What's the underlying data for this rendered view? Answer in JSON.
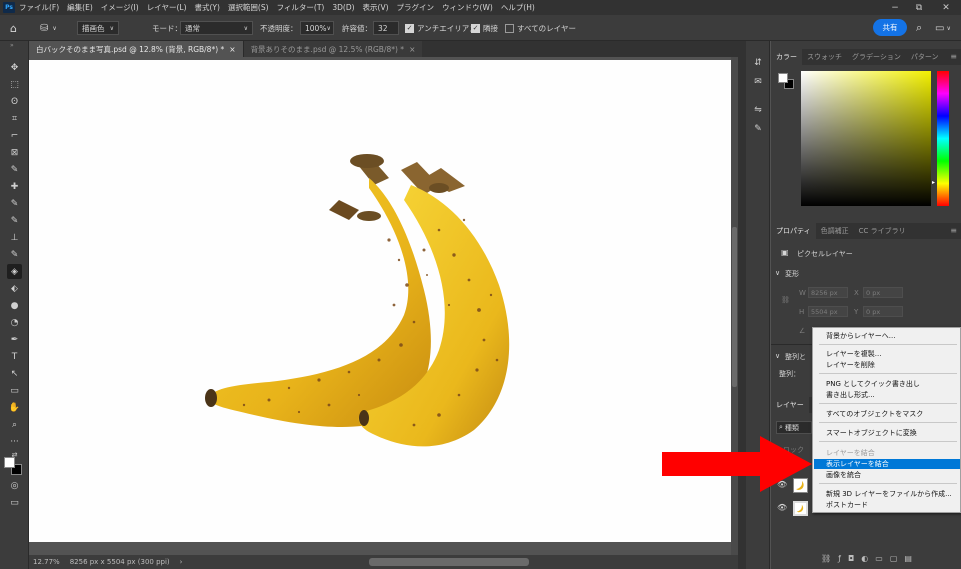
{
  "app": {
    "logo": "Ps"
  },
  "menubar": {
    "items": [
      "ファイル(F)",
      "編集(E)",
      "イメージ(I)",
      "レイヤー(L)",
      "書式(Y)",
      "選択範囲(S)",
      "フィルター(T)",
      "3D(D)",
      "表示(V)",
      "プラグイン",
      "ウィンドウ(W)",
      "ヘルプ(H)"
    ],
    "window_controls": [
      "−",
      "⧉",
      "✕"
    ]
  },
  "options": {
    "home_icon": "⌂",
    "tool_icon": "⛁",
    "fill_source": "描画色",
    "mode_label": "モード：",
    "mode_value": "通常",
    "opacity_label": "不透明度：",
    "opacity_value": "100%",
    "tolerance_label": "許容値：",
    "tolerance_value": "32",
    "antialias_label": "アンチエイリアス",
    "antialias_checked": true,
    "contiguous_label": "隣接",
    "contiguous_checked": true,
    "all_layers_label": "すべてのレイヤー",
    "all_layers_checked": false,
    "share_button": "共有",
    "search_icon": "⌕",
    "workspace_icon": "▭"
  },
  "tabs": [
    {
      "label": "白バックそのまま写真.psd @ 12.8% (背景, RGB/8*) *",
      "close": "×",
      "active": true
    },
    {
      "label": "背景ありそのまま.psd @ 12.5% (RGB/8*) *",
      "close": "×",
      "active": false
    }
  ],
  "tools": [
    "✥",
    "⬚",
    "ʘ",
    "⌗",
    "⌐",
    "⊠",
    "✎",
    "✚",
    "✎",
    "✎",
    "⊥",
    "✎",
    "◈",
    "⬖",
    "●",
    "◔",
    "✒",
    "T",
    "↖",
    "▭",
    "✋",
    "⌕",
    "···",
    "⇄",
    "□",
    "◎",
    "▭"
  ],
  "status": {
    "zoom": "12.77%",
    "doc_size": "8256 px x 5504 px (300 ppi)",
    "arrow": "›"
  },
  "icon_column": [
    "⇵",
    "✉",
    "⇋",
    "✎",
    "⇶"
  ],
  "color_panel": {
    "tabs": [
      "カラー",
      "スウォッチ",
      "グラデーション",
      "パターン"
    ],
    "menu_icon": "≡",
    "hue_color": "#f2f000"
  },
  "properties_panel": {
    "tabs": [
      "プロパティ",
      "色調補正",
      "CC ライブラリ"
    ],
    "layer_type": "ピクセルレイヤー",
    "transform_heading": "変形",
    "w_label": "W",
    "w_value": "8256 px",
    "x_label": "X",
    "x_value": "0 px",
    "h_label": "H",
    "h_value": "5504 px",
    "y_label": "Y",
    "y_value": "0 px",
    "align_heading": "整列と",
    "align_row": "整列：",
    "chevron": "∨"
  },
  "layers_panel": {
    "tab": "レイヤー",
    "search_label": "種類",
    "lock_label": "ロック",
    "eye": "👁"
  },
  "context_menu": {
    "items": [
      {
        "label": "背景からレイヤーへ...",
        "state": "normal"
      },
      {
        "label": "レイヤーを複製...",
        "state": "normal"
      },
      {
        "label": "レイヤーを削除",
        "state": "normal"
      },
      {
        "label": "PNG としてクイック書き出し",
        "state": "normal"
      },
      {
        "label": "書き出し形式...",
        "state": "normal"
      },
      {
        "label": "すべてのオブジェクトをマスク",
        "state": "normal"
      },
      {
        "label": "スマートオブジェクトに変換",
        "state": "normal"
      },
      {
        "label": "レイヤーを結合",
        "state": "disabled"
      },
      {
        "label": "表示レイヤーを結合",
        "state": "highlighted"
      },
      {
        "label": "画像を統合",
        "state": "normal"
      },
      {
        "label": "新規 3D レイヤーをファイルから作成...",
        "state": "normal"
      },
      {
        "label": "ポストカード",
        "state": "normal"
      }
    ]
  },
  "annotation": {
    "arrow_color": "#ff0000"
  },
  "colors": {
    "accent": "#0078d7",
    "share": "#1473e6",
    "panel_bg": "#3c3c3c",
    "canvas_bg": "#535353"
  }
}
